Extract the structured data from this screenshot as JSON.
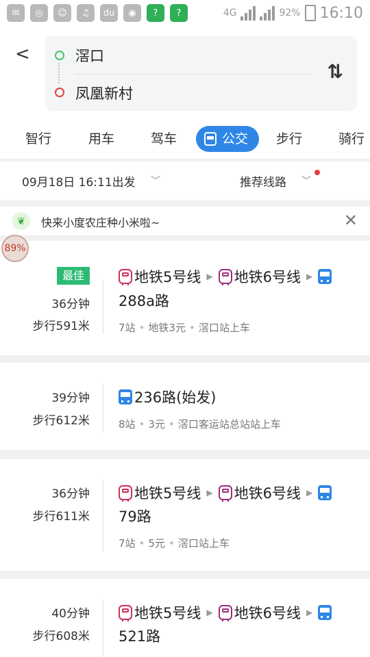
{
  "status_bar": {
    "network": "4G",
    "battery": "92%",
    "time": "16:10"
  },
  "route": {
    "from": "滘口",
    "to": "凤凰新村"
  },
  "tabs": [
    "智行",
    "用车",
    "驾车",
    "公交",
    "步行",
    "骑行"
  ],
  "active_tab": "公交",
  "options": {
    "departure": "09月18日 16:11出发",
    "sort": "推荐线路"
  },
  "banner": {
    "text": "快来小度农庄种小米啦~"
  },
  "floating_badge": "89%",
  "results": [
    {
      "badge": "最佳",
      "duration": "36分钟",
      "walk": "步行591米",
      "legs": [
        "地铁5号线",
        "地铁6号线"
      ],
      "bus": "288a路",
      "details": [
        "7站",
        "地铁3元",
        "滘口站上车"
      ]
    },
    {
      "duration": "39分钟",
      "walk": "步行612米",
      "bus": "236路(始发)",
      "details": [
        "8站",
        "3元",
        "滘口客运站总站站上车"
      ]
    },
    {
      "duration": "36分钟",
      "walk": "步行611米",
      "legs": [
        "地铁5号线",
        "地铁6号线"
      ],
      "bus": "79路",
      "details": [
        "7站",
        "5元",
        "滘口站上车"
      ]
    },
    {
      "duration": "40分钟",
      "walk": "步行608米",
      "legs": [
        "地铁5号线",
        "地铁6号线"
      ],
      "bus": "521路"
    }
  ]
}
